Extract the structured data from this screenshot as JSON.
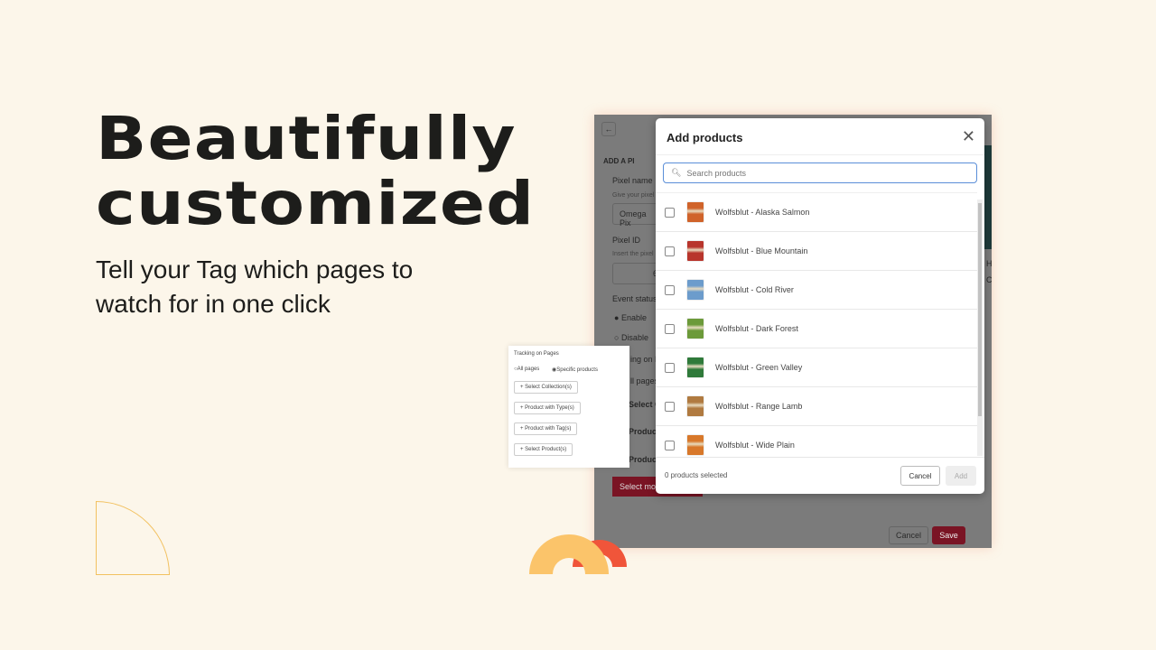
{
  "hero": {
    "title_line1": "Beautifully",
    "title_line2": "customized",
    "subtitle": "Tell your Tag which pages to watch for in one click"
  },
  "background_app": {
    "section": "ADD A PI",
    "pixel_name_label": "Pixel name",
    "pixel_name_help": "Give your pixel",
    "pixel_name_value": "Omega Pix",
    "pixel_id_label": "Pixel ID",
    "pixel_id_help": "Insert the pixel",
    "pixel_id_value": "6",
    "event_status_label": "Event status",
    "enable": "Enable",
    "disable": "Disable",
    "tracking_label": "ing on P",
    "all_pages": "ll pages",
    "select_c": "Select C",
    "product1": "Product",
    "product2": "Product",
    "select_more": "Select mo",
    "right_h": "H",
    "right_c": "C",
    "cancel": "Cancel",
    "save": "Save",
    "accent": "#9b0c26"
  },
  "modal": {
    "title": "Add products",
    "search_placeholder": "Search products",
    "products": [
      {
        "name": "Wolfsblut - Alaska Salmon",
        "color": "#d0632a"
      },
      {
        "name": "Wolfsblut - Blue Mountain",
        "color": "#b8352c"
      },
      {
        "name": "Wolfsblut - Cold River",
        "color": "#6c9ccc"
      },
      {
        "name": "Wolfsblut - Dark Forest",
        "color": "#6c9a3a"
      },
      {
        "name": "Wolfsblut - Green Valley",
        "color": "#2f7a3a"
      },
      {
        "name": "Wolfsblut - Range Lamb",
        "color": "#b07a40"
      },
      {
        "name": "Wolfsblut - Wide Plain",
        "color": "#d8782a"
      }
    ],
    "selected_count": "0 products selected",
    "cancel": "Cancel",
    "add": "Add"
  },
  "tracking_card": {
    "title": "Tracking on Pages",
    "all_pages": "All pages",
    "specific_products": "Specific products",
    "buttons": [
      "+ Select Collection(s)",
      "+ Product with Type(s)",
      "+ Product with Tag(s)",
      "+ Select Product(s)"
    ]
  }
}
